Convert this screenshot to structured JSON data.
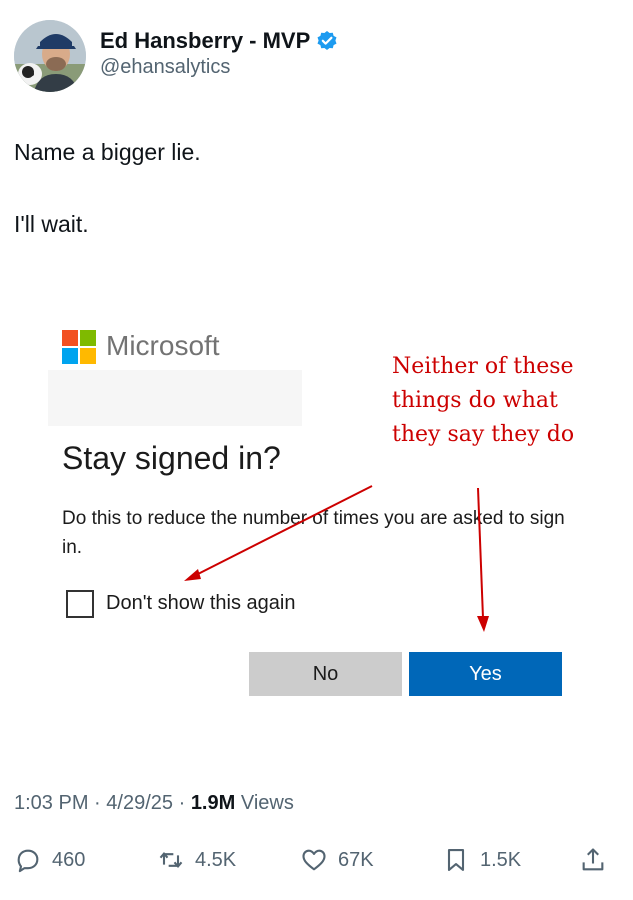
{
  "author": {
    "name": "Ed Hansberry - MVP",
    "handle": "@ehansalytics"
  },
  "tweet": {
    "lines": [
      "Name a bigger lie.",
      "I'll wait."
    ]
  },
  "media": {
    "brand": "Microsoft",
    "title": "Stay signed in?",
    "description": "Do this to reduce the number of times you are asked to sign in.",
    "checkbox_label": "Don't show this again",
    "no_label": "No",
    "yes_label": "Yes",
    "annotation": "Neither of these things do what they say they do",
    "colors": {
      "yes_button": "#0067b8",
      "no_button": "#cccccc",
      "annotation": "#cc0000",
      "logo_red": "#f25022",
      "logo_green": "#7fba00",
      "logo_blue": "#00a4ef",
      "logo_yellow": "#ffb900"
    }
  },
  "meta": {
    "time": "1:03 PM",
    "separator": "·",
    "date": "4/29/25",
    "views_count": "1.9M",
    "views_label": "Views"
  },
  "actions": {
    "replies": "460",
    "reposts": "4.5K",
    "likes": "67K",
    "bookmarks": "1.5K"
  },
  "icons": [
    "verified-badge-icon",
    "reply-icon",
    "repost-icon",
    "like-icon",
    "bookmark-icon",
    "share-icon"
  ]
}
